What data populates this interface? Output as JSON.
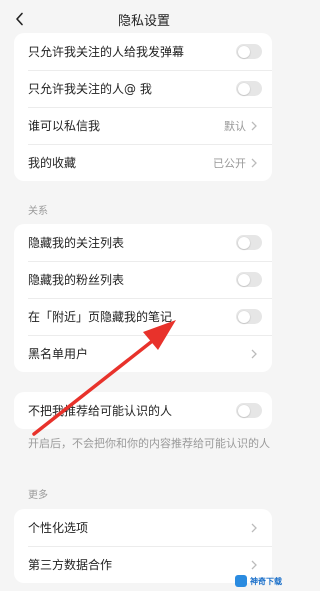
{
  "nav": {
    "title": "隐私设置"
  },
  "card1": {
    "rows": [
      {
        "label": "只允许我关注的人给我发弹幕",
        "toggle": "off"
      },
      {
        "label": "只允许我关注的人@ 我",
        "toggle": "off"
      },
      {
        "label": "谁可以私信我",
        "value": "默认"
      },
      {
        "label": "我的收藏",
        "value": "已公开"
      }
    ]
  },
  "section_relations": {
    "title": "关系"
  },
  "card2": {
    "rows": [
      {
        "label": "隐藏我的关注列表",
        "toggle": "off"
      },
      {
        "label": "隐藏我的粉丝列表",
        "toggle": "off"
      },
      {
        "label": "在「附近」页隐藏我的笔记",
        "toggle": "off"
      },
      {
        "label": "黑名单用户"
      }
    ]
  },
  "card3": {
    "rows": [
      {
        "label": "不把我推荐给可能认识的人",
        "toggle": "off"
      }
    ],
    "note": "开启后，不会把你和你的内容推荐给可能认识的人"
  },
  "section_more": {
    "title": "更多"
  },
  "card4": {
    "rows": [
      {
        "label": "个性化选项"
      },
      {
        "label": "第三方数据合作"
      }
    ]
  },
  "watermark": {
    "text": "神奇下载"
  },
  "colors": {
    "arrow": "#e8322b",
    "background": "#f5f5f5",
    "card": "#ffffff",
    "toggle_off": "#e6e6e6"
  }
}
